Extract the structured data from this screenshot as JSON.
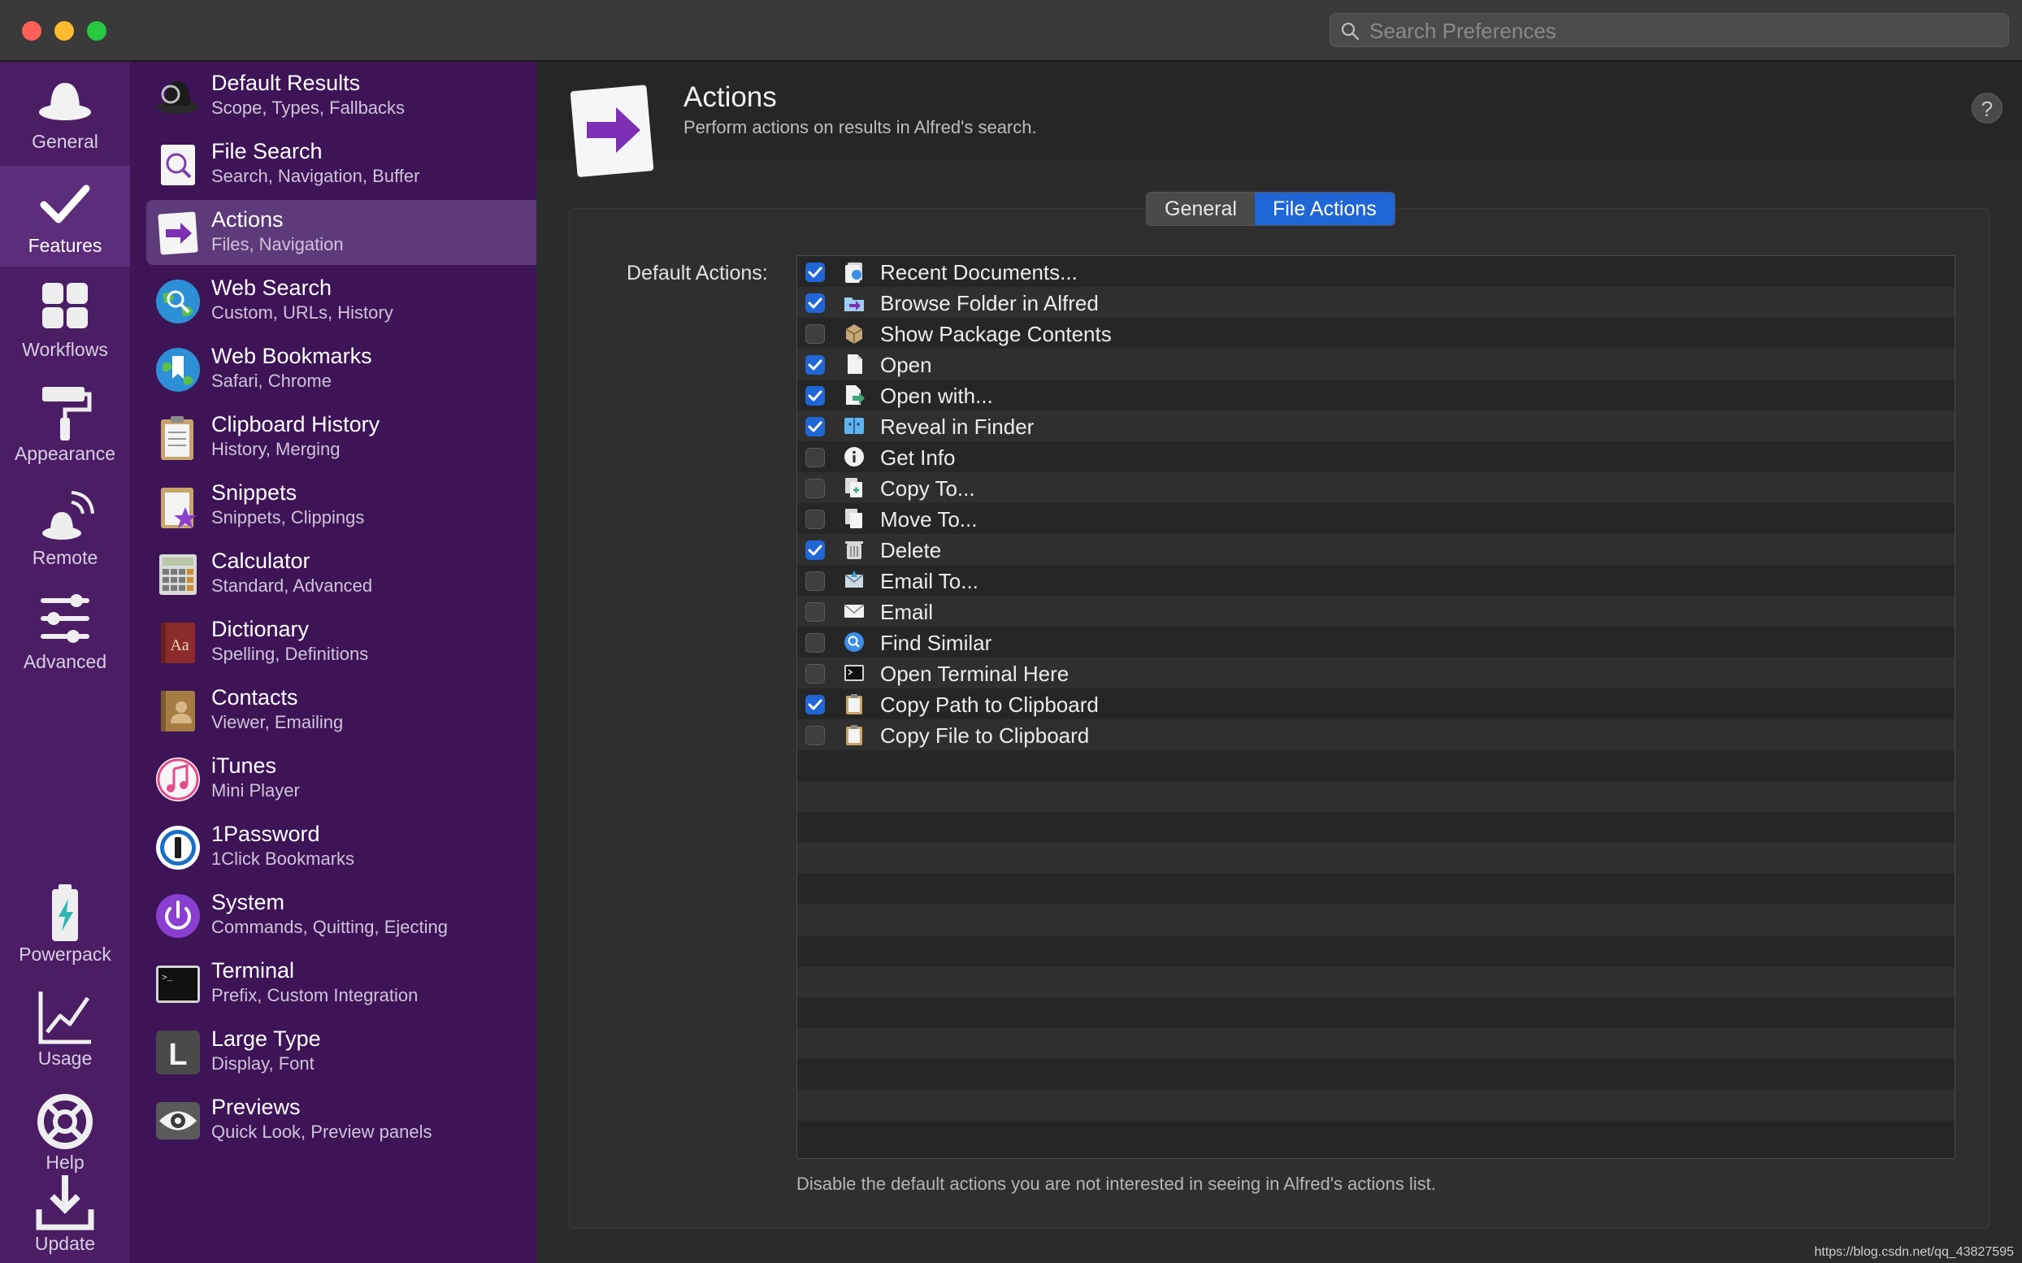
{
  "window": {
    "search_placeholder": "Search Preferences"
  },
  "categories": [
    {
      "label": "General",
      "icon": "hat-icon"
    },
    {
      "label": "Features",
      "icon": "checkmark-icon"
    },
    {
      "label": "Workflows",
      "icon": "grid-icon"
    },
    {
      "label": "Appearance",
      "icon": "paint-roller-icon"
    },
    {
      "label": "Remote",
      "icon": "remote-icon"
    },
    {
      "label": "Advanced",
      "icon": "sliders-icon"
    },
    {
      "label": "Powerpack",
      "icon": "battery-bolt-icon"
    },
    {
      "label": "Usage",
      "icon": "chart-icon"
    },
    {
      "label": "Help",
      "icon": "lifebuoy-icon"
    },
    {
      "label": "Update",
      "icon": "download-icon"
    }
  ],
  "features": [
    {
      "title": "Default Results",
      "subtitle": "Scope, Types, Fallbacks",
      "icon": "magnifier-hat-icon"
    },
    {
      "title": "File Search",
      "subtitle": "Search, Navigation, Buffer",
      "icon": "file-search-icon"
    },
    {
      "title": "Actions",
      "subtitle": "Files, Navigation",
      "icon": "actions-arrow-icon"
    },
    {
      "title": "Web Search",
      "subtitle": "Custom, URLs, History",
      "icon": "globe-search-icon"
    },
    {
      "title": "Web Bookmarks",
      "subtitle": "Safari, Chrome",
      "icon": "globe-bookmark-icon"
    },
    {
      "title": "Clipboard History",
      "subtitle": "History, Merging",
      "icon": "clipboard-icon"
    },
    {
      "title": "Snippets",
      "subtitle": "Snippets, Clippings",
      "icon": "snippets-icon"
    },
    {
      "title": "Calculator",
      "subtitle": "Standard, Advanced",
      "icon": "calculator-icon"
    },
    {
      "title": "Dictionary",
      "subtitle": "Spelling, Definitions",
      "icon": "dictionary-icon"
    },
    {
      "title": "Contacts",
      "subtitle": "Viewer, Emailing",
      "icon": "contacts-icon"
    },
    {
      "title": "iTunes",
      "subtitle": "Mini Player",
      "icon": "itunes-icon"
    },
    {
      "title": "1Password",
      "subtitle": "1Click Bookmarks",
      "icon": "1password-icon"
    },
    {
      "title": "System",
      "subtitle": "Commands, Quitting, Ejecting",
      "icon": "power-icon"
    },
    {
      "title": "Terminal",
      "subtitle": "Prefix, Custom Integration",
      "icon": "terminal-icon"
    },
    {
      "title": "Large Type",
      "subtitle": "Display, Font",
      "icon": "large-type-icon"
    },
    {
      "title": "Previews",
      "subtitle": "Quick Look, Preview panels",
      "icon": "eye-icon"
    }
  ],
  "header": {
    "title": "Actions",
    "subtitle": "Perform actions on results in Alfred's search."
  },
  "tabs": [
    {
      "label": "General",
      "active": false
    },
    {
      "label": "File Actions",
      "active": true
    }
  ],
  "default_actions_label": "Default Actions:",
  "actions": [
    {
      "label": "Recent Documents...",
      "checked": true,
      "icon": "recent-documents-icon"
    },
    {
      "label": "Browse Folder in Alfred",
      "checked": true,
      "icon": "browse-folder-icon"
    },
    {
      "label": "Show Package Contents",
      "checked": false,
      "icon": "package-icon"
    },
    {
      "label": "Open",
      "checked": true,
      "icon": "document-icon"
    },
    {
      "label": "Open with...",
      "checked": true,
      "icon": "open-with-icon"
    },
    {
      "label": "Reveal in Finder",
      "checked": true,
      "icon": "finder-icon"
    },
    {
      "label": "Get Info",
      "checked": false,
      "icon": "info-icon"
    },
    {
      "label": "Copy To...",
      "checked": false,
      "icon": "copy-to-icon"
    },
    {
      "label": "Move To...",
      "checked": false,
      "icon": "move-to-icon"
    },
    {
      "label": "Delete",
      "checked": true,
      "icon": "trash-icon"
    },
    {
      "label": "Email To...",
      "checked": false,
      "icon": "email-to-icon"
    },
    {
      "label": "Email",
      "checked": false,
      "icon": "envelope-icon"
    },
    {
      "label": "Find Similar",
      "checked": false,
      "icon": "find-similar-icon"
    },
    {
      "label": "Open Terminal Here",
      "checked": false,
      "icon": "terminal-icon"
    },
    {
      "label": "Copy Path to Clipboard",
      "checked": true,
      "icon": "clipboard-path-icon"
    },
    {
      "label": "Copy File to Clipboard",
      "checked": false,
      "icon": "clipboard-file-icon"
    }
  ],
  "footnote": "Disable the default actions you are not interested in seeing in Alfred's actions list.",
  "watermark": "https://blog.csdn.net/qq_43827595",
  "colors": {
    "accent": "#1f66d6",
    "category_bar": "#4a1d65",
    "feature_list": "#3d1456",
    "close": "#fe5f57",
    "minimize": "#febc2e",
    "maximize": "#28c840"
  }
}
